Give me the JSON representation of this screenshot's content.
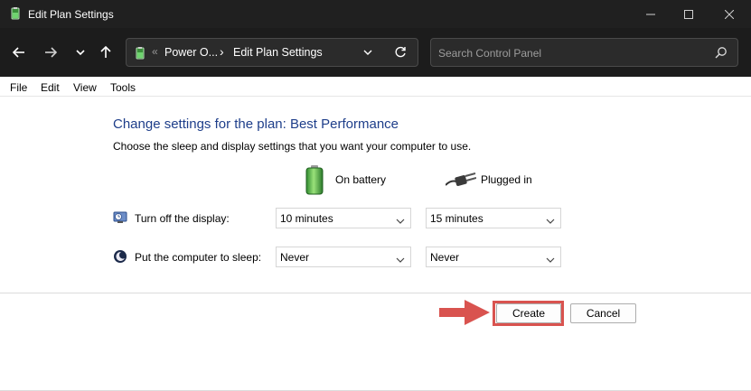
{
  "window": {
    "title": "Edit Plan Settings",
    "app_icon": "power-options-icon"
  },
  "nav": {
    "address": {
      "overflow": "«",
      "crumbs": [
        "Power O...",
        "Edit Plan Settings"
      ]
    },
    "search": {
      "placeholder": "Search Control Panel"
    }
  },
  "menu": {
    "items": [
      "File",
      "Edit",
      "View",
      "Tools"
    ]
  },
  "content": {
    "heading": "Change settings for the plan: Best Performance",
    "subtext": "Choose the sleep and display settings that you want your computer to use.",
    "columns": [
      {
        "label": "On battery",
        "icon": "battery-icon"
      },
      {
        "label": "Plugged in",
        "icon": "power-plug-icon"
      }
    ],
    "rows": [
      {
        "label": "Turn off the display:",
        "icon": "display-timer-icon",
        "on_battery": "10 minutes",
        "plugged_in": "15 minutes"
      },
      {
        "label": "Put the computer to sleep:",
        "icon": "sleep-moon-icon",
        "on_battery": "Never",
        "plugged_in": "Never"
      }
    ]
  },
  "footer": {
    "create_label": "Create",
    "cancel_label": "Cancel"
  },
  "annotation": {
    "highlight_color": "#d9534f",
    "pointer": "red-arrow-icon"
  }
}
